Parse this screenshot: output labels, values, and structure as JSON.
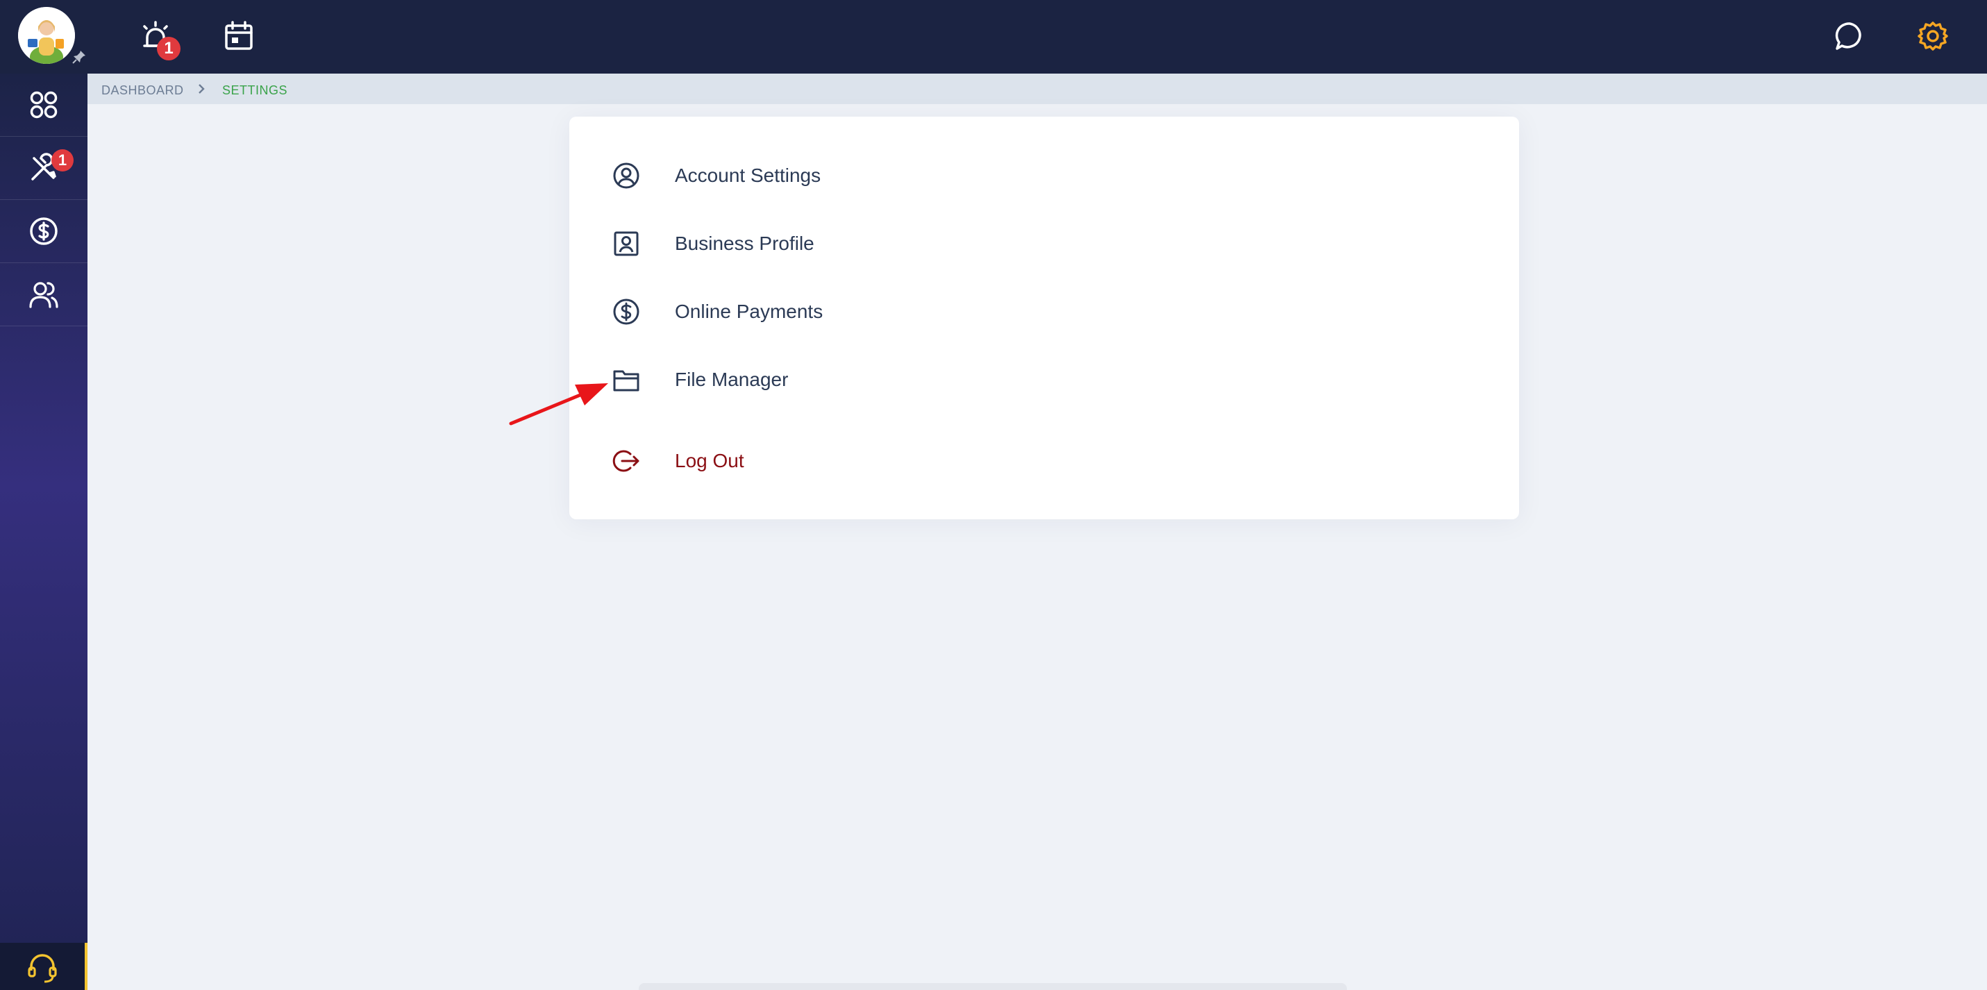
{
  "header": {
    "alerts_badge": "1",
    "icons": [
      "alarm-icon",
      "calendar-icon",
      "chat-icon",
      "gear-icon"
    ],
    "colors": {
      "background": "#1b2342",
      "gear": "#f5a623",
      "badge": "#e03a3e"
    }
  },
  "sidebar": {
    "items": [
      {
        "name": "dashboard",
        "icon": "grid-icon"
      },
      {
        "name": "tools",
        "icon": "tools-icon",
        "badge": "1"
      },
      {
        "name": "payments",
        "icon": "dollar-icon"
      },
      {
        "name": "customers",
        "icon": "users-icon"
      }
    ],
    "support_icon": "headset-icon"
  },
  "breadcrumb": {
    "items": [
      "DASHBOARD",
      "SETTINGS"
    ]
  },
  "settings_menu": {
    "items": [
      {
        "label": "Account Settings",
        "icon": "user-circle-icon"
      },
      {
        "label": "Business Profile",
        "icon": "profile-card-icon"
      },
      {
        "label": "Online Payments",
        "icon": "dollar-icon"
      },
      {
        "label": "File Manager",
        "icon": "folder-icon"
      },
      {
        "label": "Log Out",
        "icon": "logout-icon"
      }
    ]
  },
  "colors": {
    "accent_green": "#3aa34a",
    "logout_red": "#8b0f14",
    "annotation_arrow": "#e8161a"
  }
}
